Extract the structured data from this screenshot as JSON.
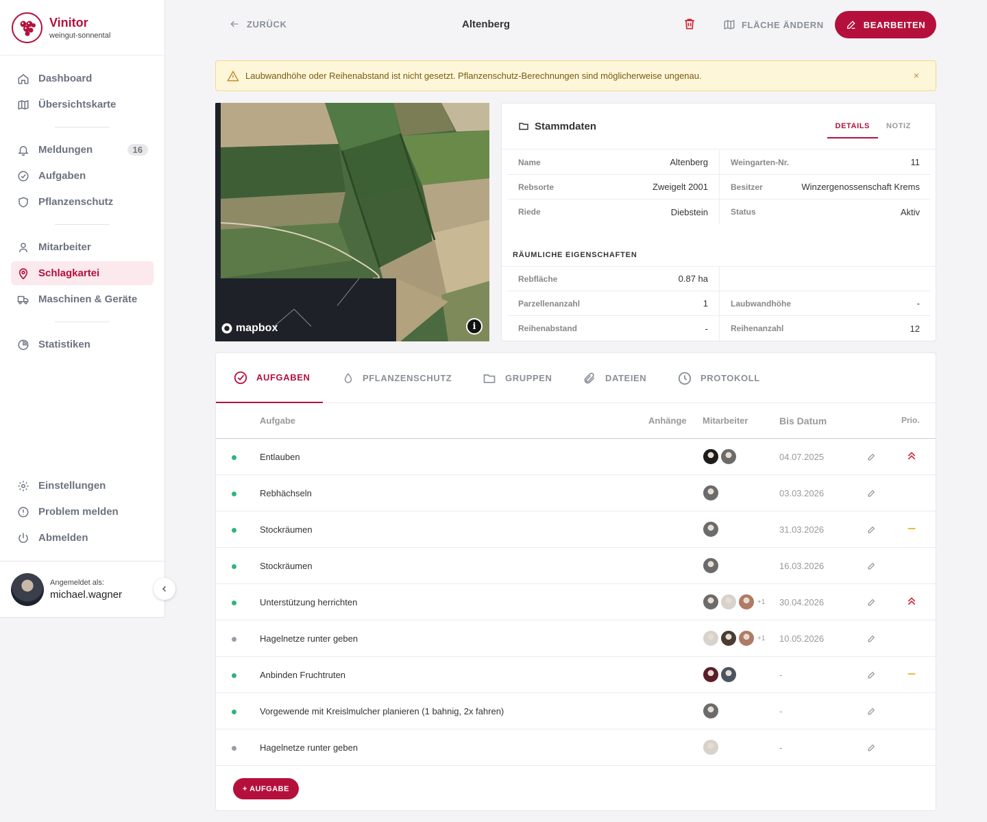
{
  "brand": {
    "name": "Vinitor",
    "tenant": "weingut-sonnental"
  },
  "nav": {
    "group1": [
      {
        "label": "Dashboard",
        "icon": "home-icon"
      },
      {
        "label": "Übersichtskarte",
        "icon": "map-icon"
      }
    ],
    "group2": [
      {
        "label": "Meldungen",
        "icon": "bell-icon",
        "badge": "16"
      },
      {
        "label": "Aufgaben",
        "icon": "check-circle-icon"
      },
      {
        "label": "Pflanzenschutz",
        "icon": "shield-icon"
      }
    ],
    "group3": [
      {
        "label": "Mitarbeiter",
        "icon": "user-icon"
      },
      {
        "label": "Schlagkartei",
        "icon": "location-pin-icon",
        "active": true
      },
      {
        "label": "Maschinen & Geräte",
        "icon": "truck-icon"
      }
    ],
    "group4": [
      {
        "label": "Statistiken",
        "icon": "pie-chart-icon"
      }
    ],
    "bottom": [
      {
        "label": "Einstellungen",
        "icon": "gear-icon"
      },
      {
        "label": "Problem melden",
        "icon": "alert-circle-icon"
      },
      {
        "label": "Abmelden",
        "icon": "power-icon"
      }
    ]
  },
  "user": {
    "caption": "Angemeldet als:",
    "name": "michael.wagner"
  },
  "header": {
    "back": "ZURÜCK",
    "title": "Altenberg",
    "area_change": "FLÄCHE ÄNDERN",
    "edit": "BEARBEITEN"
  },
  "alert": {
    "text": "Laubwandhöhe oder Reihenabstand ist nicht gesetzt. Pflanzenschutz-Berechnungen sind möglicherweise ungenau.",
    "close": "×"
  },
  "map": {
    "attribution": "mapbox",
    "info": "i"
  },
  "master": {
    "title": "Stammdaten",
    "tabs": [
      "DETAILS",
      "NOTIZ"
    ],
    "rows": [
      {
        "l1": "Name",
        "v1": "Altenberg",
        "l2": "Weingarten-Nr.",
        "v2": "11"
      },
      {
        "l1": "Rebsorte",
        "v1": "Zweigelt 2001",
        "l2": "Besitzer",
        "v2": "Winzergenossenschaft Krems"
      },
      {
        "l1": "Riede",
        "v1": "Diebstein",
        "l2": "Status",
        "v2": "Aktiv"
      }
    ],
    "spatial_title": "RÄUMLICHE EIGENSCHAFTEN",
    "spatial": [
      {
        "l1": "Rebfläche",
        "v1": "0.87 ha",
        "l2": "",
        "v2": ""
      },
      {
        "l1": "Parzellenanzahl",
        "v1": "1",
        "l2": "Laubwandhöhe",
        "v2": "-"
      },
      {
        "l1": "Reihenabstand",
        "v1": "-",
        "l2": "Reihenanzahl",
        "v2": "12"
      }
    ]
  },
  "tabs": [
    "AUFGABEN",
    "PFLANZENSCHUTZ",
    "GRUPPEN",
    "DATEIEN",
    "PROTOKOLL"
  ],
  "table": {
    "columns": {
      "task": "Aufgabe",
      "attachments": "Anhänge",
      "staff": "Mitarbeiter",
      "due": "Bis Datum",
      "prio": "Prio."
    },
    "rows": [
      {
        "name": "Entlauben",
        "status": "#2fb47c",
        "avatars": [
          "#1c1c1c",
          "#6b6b6b"
        ],
        "more": "",
        "due": "04.07.2025",
        "prio": "high"
      },
      {
        "name": "Rebhächseln",
        "status": "#2fb47c",
        "avatars": [
          "#6b6b6b"
        ],
        "more": "",
        "due": "03.03.2026",
        "prio": ""
      },
      {
        "name": "Stockräumen",
        "status": "#2fb47c",
        "avatars": [
          "#6b6b6b"
        ],
        "more": "",
        "due": "31.03.2026",
        "prio": "medium"
      },
      {
        "name": "Stockräumen",
        "status": "#2fb47c",
        "avatars": [
          "#6b6b6b"
        ],
        "more": "",
        "due": "16.03.2026",
        "prio": ""
      },
      {
        "name": "Unterstützung herrichten",
        "status": "#2fb47c",
        "avatars": [
          "#6b6b6b",
          "#d8d2cc",
          "#b07a64"
        ],
        "more": "+1",
        "due": "30.04.2026",
        "prio": "high"
      },
      {
        "name": "Hagelnetze runter geben",
        "status": "#9a9aaa",
        "avatars": [
          "#d8d2cc",
          "#4a3b35",
          "#b07a64"
        ],
        "more": "+1",
        "due": "10.05.2026",
        "prio": ""
      },
      {
        "name": "Anbinden Fruchtruten",
        "status": "#2fb47c",
        "avatars": [
          "#5a1e2a",
          "#4a5560"
        ],
        "more": "",
        "due": "-",
        "prio": "medium"
      },
      {
        "name": "Vorgewende mit Kreislmulcher planieren (1 bahnig, 2x fahren)",
        "status": "#2fb47c",
        "avatars": [
          "#6b6b6b"
        ],
        "more": "",
        "due": "-",
        "prio": ""
      },
      {
        "name": "Hagelnetze runter geben",
        "status": "#9a9aaa",
        "avatars": [
          "#d8d2cc"
        ],
        "more": "",
        "due": "-",
        "prio": ""
      }
    ],
    "add": "+ AUFGABE"
  },
  "colors": {
    "accent": "#b5103c",
    "status_done": "#2fb47c",
    "status_open": "#9a9aaa",
    "prio_high": "#d0212f",
    "prio_medium": "#e8b11b"
  }
}
